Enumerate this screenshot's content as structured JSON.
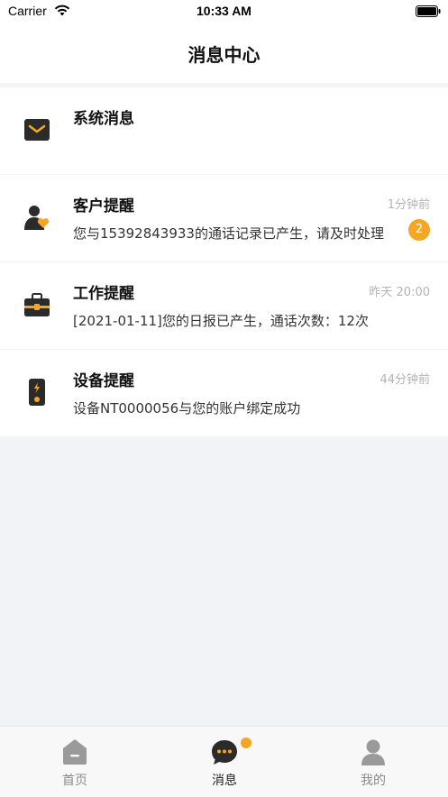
{
  "status_bar": {
    "carrier": "Carrier",
    "time": "10:33 AM"
  },
  "header": {
    "title": "消息中心"
  },
  "messages": [
    {
      "icon": "envelope-icon",
      "title": "系统消息",
      "time": "",
      "preview": "",
      "badge": ""
    },
    {
      "icon": "customer-heart-icon",
      "title": "客户提醒",
      "time": "1分钟前",
      "preview": "您与15392843933的通话记录已产生，请及时处理",
      "badge": "2"
    },
    {
      "icon": "briefcase-icon",
      "title": "工作提醒",
      "time": "昨天 20:00",
      "preview": "[2021-01-11]您的日报已产生，通话次数：12次",
      "badge": ""
    },
    {
      "icon": "device-icon",
      "title": "设备提醒",
      "time": "44分钟前",
      "preview": "设备NT0000056与您的账户绑定成功",
      "badge": ""
    }
  ],
  "tab_bar": {
    "tabs": [
      {
        "label": "首页",
        "icon": "home-icon",
        "active": false
      },
      {
        "label": "消息",
        "icon": "chat-bubble-icon",
        "active": true
      },
      {
        "label": "我的",
        "icon": "person-icon",
        "active": false
      }
    ]
  },
  "colors": {
    "accent": "#f5a623",
    "background": "#f2f3f7",
    "icon_dark": "#2b2b2b"
  }
}
